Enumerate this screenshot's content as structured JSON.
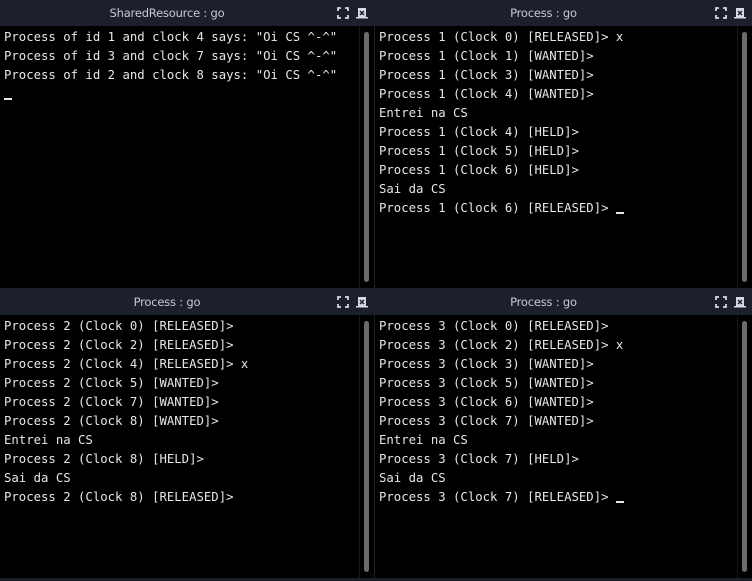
{
  "panes": [
    {
      "title": "SharedResource : go",
      "lines": [
        "Process of id 1 and clock 4 says: \"Oi CS ^-^\"",
        "Process of id 3 and clock 7 says: \"Oi CS ^-^\"",
        "Process of id 2 and clock 8 says: \"Oi CS ^-^\"",
        ""
      ],
      "cursor_line": 3,
      "maximize_icon": "maximize-icon",
      "close_icon": "close-icon"
    },
    {
      "title": "Process : go",
      "lines": [
        "Process 1 (Clock 0) [RELEASED]> x",
        "Process 1 (Clock 1) [WANTED]>",
        "Process 1 (Clock 3) [WANTED]>",
        "Process 1 (Clock 4) [WANTED]>",
        "Entrei na CS",
        "Process 1 (Clock 4) [HELD]>",
        "Process 1 (Clock 5) [HELD]>",
        "Process 1 (Clock 6) [HELD]>",
        "Sai da CS",
        "Process 1 (Clock 6) [RELEASED]> "
      ],
      "cursor_line": 9,
      "maximize_icon": "maximize-icon",
      "close_icon": "close-icon"
    },
    {
      "title": "Process : go",
      "lines": [
        "Process 2 (Clock 0) [RELEASED]>",
        "Process 2 (Clock 2) [RELEASED]>",
        "Process 2 (Clock 4) [RELEASED]> x",
        "Process 2 (Clock 5) [WANTED]>",
        "Process 2 (Clock 7) [WANTED]>",
        "Process 2 (Clock 8) [WANTED]>",
        "Entrei na CS",
        "Process 2 (Clock 8) [HELD]>",
        "Sai da CS",
        "Process 2 (Clock 8) [RELEASED]>"
      ],
      "cursor_line": null,
      "maximize_icon": "maximize-icon",
      "close_icon": "close-icon"
    },
    {
      "title": "Process : go",
      "lines": [
        "Process 3 (Clock 0) [RELEASED]>",
        "Process 3 (Clock 2) [RELEASED]> x",
        "Process 3 (Clock 3) [WANTED]>",
        "Process 3 (Clock 5) [WANTED]>",
        "Process 3 (Clock 6) [WANTED]>",
        "Process 3 (Clock 7) [WANTED]>",
        "Entrei na CS",
        "Process 3 (Clock 7) [HELD]>",
        "Sai da CS",
        "Process 3 (Clock 7) [RELEASED]> "
      ],
      "cursor_line": 9,
      "maximize_icon": "maximize-icon",
      "close_icon": "close-icon"
    }
  ],
  "colors": {
    "header_bg": "#1c1f2c",
    "header_text": "#c8cad2",
    "terminal_bg": "#000000",
    "terminal_text": "#e6e6e6",
    "scroll_thumb": "#6b6b6e"
  }
}
